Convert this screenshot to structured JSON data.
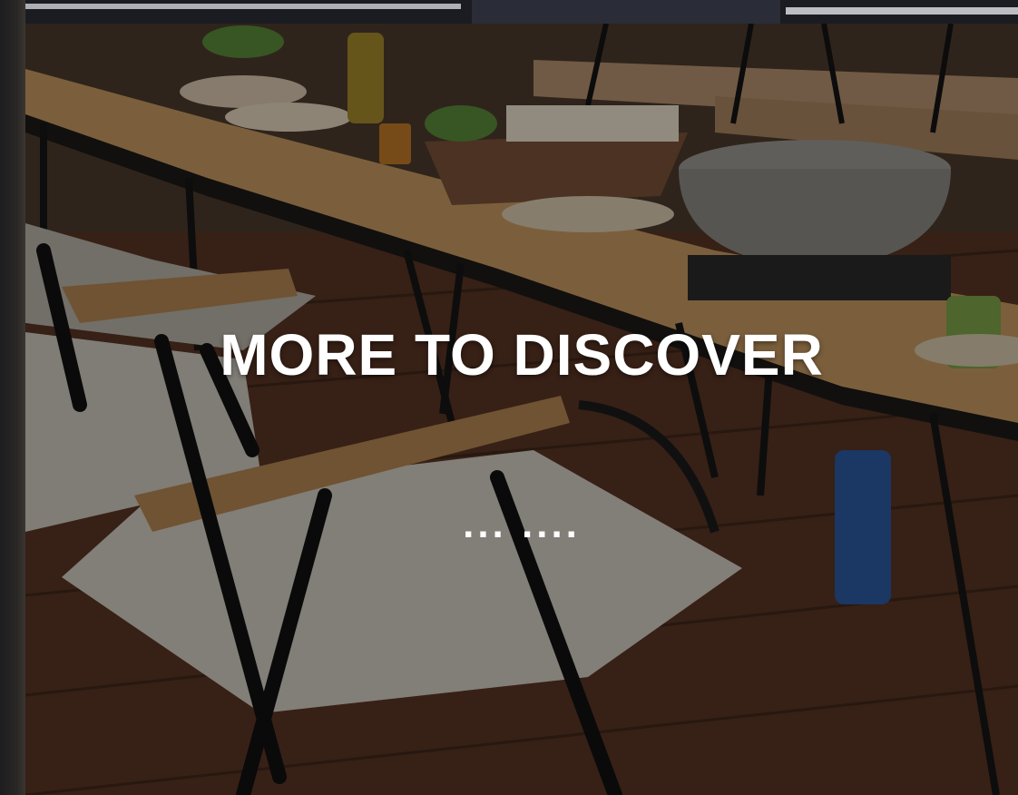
{
  "hero": {
    "headline": "MORE TO DISCOVER",
    "loading_text": "... ...."
  },
  "colors": {
    "headline": "#ffffff",
    "overlay": "rgba(0,0,0,0.38)",
    "deck_wood": "#4a2e1e",
    "table_top": "#c79a62"
  }
}
